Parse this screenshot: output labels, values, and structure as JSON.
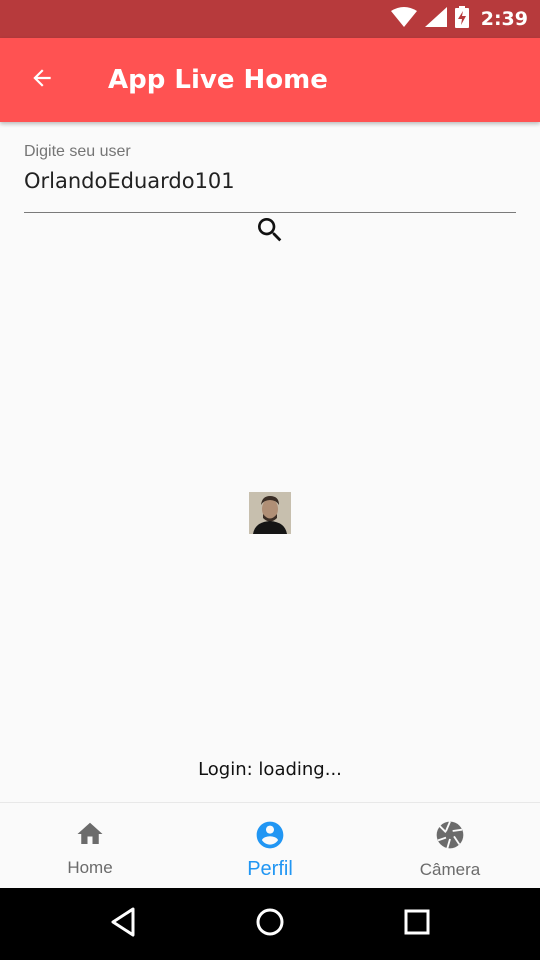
{
  "status_bar": {
    "time": "2:39",
    "icons": [
      "wifi-icon",
      "signal-icon",
      "battery-charging-icon"
    ]
  },
  "app_bar": {
    "title": "App Live Home",
    "back_icon": "arrow-back-icon",
    "color": "#ff5252"
  },
  "user_field": {
    "label": "Digite seu user",
    "value": "OrlandoEduardo101"
  },
  "search": {
    "icon": "search-icon"
  },
  "profile": {
    "avatar": "user-avatar-photo"
  },
  "login": {
    "status": "Login: loading..."
  },
  "bottom_nav": {
    "items": [
      {
        "label": "Home",
        "icon": "home-icon",
        "active": false
      },
      {
        "label": "Perfil",
        "icon": "account-circle-icon",
        "active": true
      },
      {
        "label": "Câmera",
        "icon": "camera-shutter-icon",
        "active": false
      }
    ],
    "active_color": "#2196f3"
  },
  "system_nav": {
    "icons": [
      "back-triangle-icon",
      "home-circle-icon",
      "recents-square-icon"
    ]
  }
}
